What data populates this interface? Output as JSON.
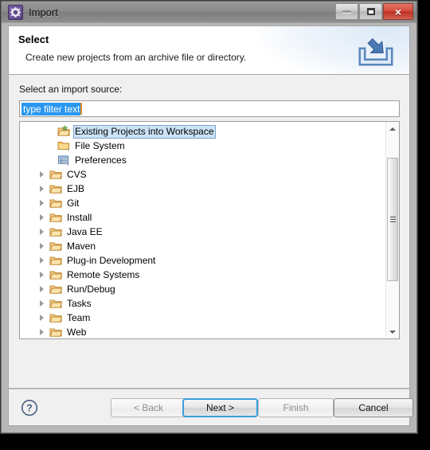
{
  "window": {
    "title": "Import",
    "icon": "gear-icon",
    "controls": {
      "minimize": "minimize",
      "maximize": "maximize",
      "close": "×"
    }
  },
  "header": {
    "title": "Select",
    "subtitle": "Create new projects from an archive file or directory.",
    "icon": "import-tray-icon"
  },
  "body": {
    "label": "Select an import source:",
    "filter": {
      "value": "type filter text",
      "placeholder": "type filter text",
      "selected": true
    }
  },
  "tree": {
    "items": [
      {
        "label": "Existing Projects into Workspace",
        "icon": "open-folder-new-icon",
        "expandable": false,
        "selected": true
      },
      {
        "label": "File System",
        "icon": "folder-icon",
        "expandable": false,
        "selected": false
      },
      {
        "label": "Preferences",
        "icon": "preferences-icon",
        "expandable": false,
        "selected": false
      },
      {
        "label": "CVS",
        "icon": "folder-open-icon",
        "expandable": true,
        "selected": false
      },
      {
        "label": "EJB",
        "icon": "folder-open-icon",
        "expandable": true,
        "selected": false
      },
      {
        "label": "Git",
        "icon": "folder-open-icon",
        "expandable": true,
        "selected": false
      },
      {
        "label": "Install",
        "icon": "folder-open-icon",
        "expandable": true,
        "selected": false
      },
      {
        "label": "Java EE",
        "icon": "folder-open-icon",
        "expandable": true,
        "selected": false
      },
      {
        "label": "Maven",
        "icon": "folder-open-icon",
        "expandable": true,
        "selected": false
      },
      {
        "label": "Plug-in Development",
        "icon": "folder-open-icon",
        "expandable": true,
        "selected": false
      },
      {
        "label": "Remote Systems",
        "icon": "folder-open-icon",
        "expandable": true,
        "selected": false
      },
      {
        "label": "Run/Debug",
        "icon": "folder-open-icon",
        "expandable": true,
        "selected": false
      },
      {
        "label": "Tasks",
        "icon": "folder-open-icon",
        "expandable": true,
        "selected": false
      },
      {
        "label": "Team",
        "icon": "folder-open-icon",
        "expandable": true,
        "selected": false
      },
      {
        "label": "Web",
        "icon": "folder-open-icon",
        "expandable": true,
        "selected": false
      }
    ],
    "scrollbar": {
      "up": "scroll-up",
      "down": "scroll-down"
    }
  },
  "footer": {
    "help": "help-icon",
    "buttons": {
      "back": "< Back",
      "next": "Next >",
      "finish": "Finish",
      "cancel": "Cancel"
    }
  },
  "colors": {
    "selection_blue": "#2b97f0",
    "tree_selection": "#cde3f7",
    "focus_ring": "#3c9ddd",
    "folder": "#f0b44a",
    "close_red": "#c8392b"
  }
}
